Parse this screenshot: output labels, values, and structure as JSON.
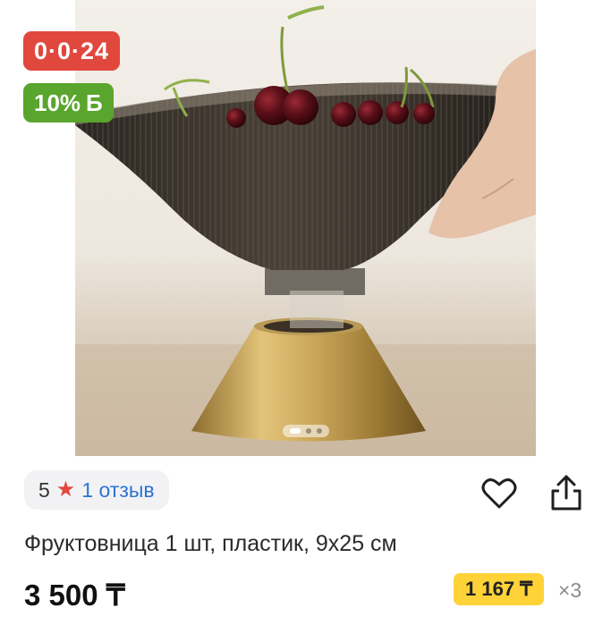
{
  "badges": {
    "timer": "0·0·24",
    "bonus": "10%",
    "bonus_icon": "Б"
  },
  "gallery": {
    "image_alt": "fruit bowl with cherries",
    "pages": 3,
    "active_index": 0
  },
  "rating": {
    "value": "5",
    "star_icon": "star-icon",
    "reviews_label": "1 отзыв"
  },
  "actions": {
    "favorite_icon": "heart-icon",
    "share_icon": "share-icon"
  },
  "product": {
    "title": "Фруктовница 1 шт, пластик, 9х25 см",
    "price": "3 500 ₸"
  },
  "installment": {
    "amount": "1 167 ₸",
    "multiplier": "×3"
  },
  "colors": {
    "timer_badge": "#e0483d",
    "bonus_badge": "#5aa52d",
    "link": "#2b73d6",
    "installment_bg": "#ffd338"
  }
}
